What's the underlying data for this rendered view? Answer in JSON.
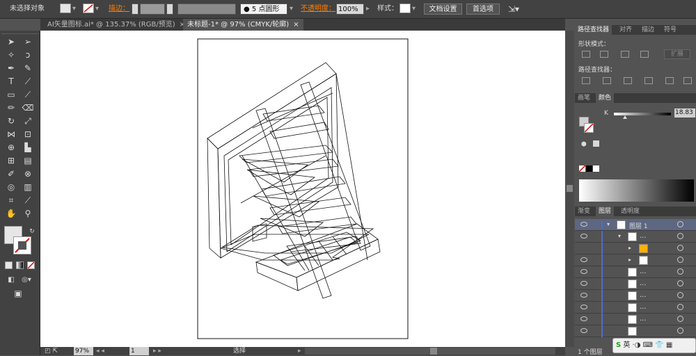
{
  "control_bar": {
    "no_selection": "未选择对象",
    "stroke_label": "描边：",
    "brush_size": "5 点圆形",
    "opacity_label": "不透明度：",
    "opacity_value": "100%",
    "style_label": "样式：",
    "doc_setup_btn": "文档设置",
    "preferences_btn": "首选项"
  },
  "doc_tabs": [
    {
      "label": "AI矢量图标.ai* @ 135.37% (RGB/预览)",
      "active": false
    },
    {
      "label": "未标题-1* @ 97% (CMYK/轮廓)",
      "active": true
    }
  ],
  "tab_close": "×",
  "status": {
    "zoom": "97%",
    "page": "1",
    "mode": "选择"
  },
  "pathfinder": {
    "tabs": [
      "路径查找器",
      "对齐",
      "描边",
      "符号"
    ],
    "shape_modes": "形状模式：",
    "expand_btn": "扩展",
    "pathfinders": "路径查找器："
  },
  "color": {
    "tabs": [
      "画笔",
      "颜色"
    ],
    "channel": "K",
    "value": "18.83",
    "k_fraction": 0.19
  },
  "layers": {
    "tabs": [
      "渐变",
      "图层",
      "透明度"
    ],
    "top_layer": "图层 1",
    "sub_label": "...",
    "count": "1 个图层"
  },
  "colors": {
    "accent": "#ff7e00",
    "layer_bar": "#4d6ec8",
    "panel": "#535353",
    "chrome": "#424242"
  },
  "icons": [
    "selection-icon",
    "direct-selection-icon",
    "pen-icon",
    "type-icon",
    "hand-icon",
    "zoom-icon",
    "eye-icon"
  ]
}
